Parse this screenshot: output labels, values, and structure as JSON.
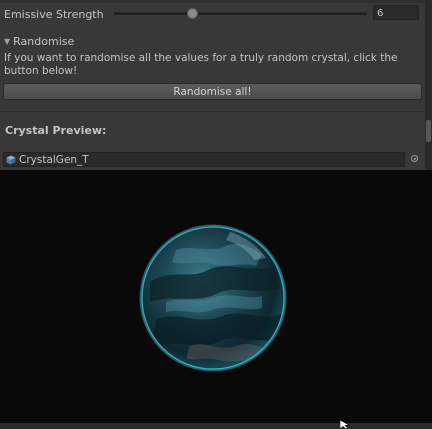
{
  "emissive": {
    "label": "Emissive Strength",
    "value": "6",
    "level": 0.31
  },
  "randomise": {
    "foldout_label": "Randomise",
    "description": "If you want to randomise all the values for a truly random crystal, click the button below!",
    "button_label": "Randomise all!"
  },
  "preview": {
    "title": "Crystal Preview:",
    "object_name": "CrystalGen_T"
  },
  "colors": {
    "crystal_edge": "#3ec6d8",
    "crystal_dark": "#0d2a33",
    "crystal_mid": "#2e6b7a"
  },
  "icons": [
    "foldout-arrow-icon",
    "prefab-cube-icon",
    "object-picker-icon",
    "mouse-cursor-icon"
  ]
}
